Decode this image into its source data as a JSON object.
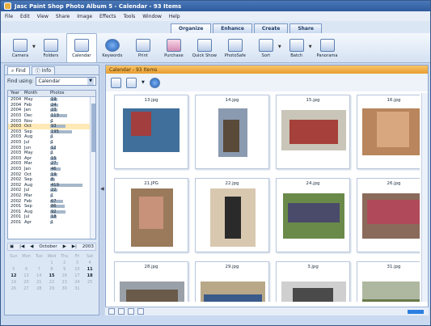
{
  "window": {
    "title": "Jasc Paint Shop Photo Album 5 - Calendar - 93 Items"
  },
  "menu": [
    "File",
    "Edit",
    "View",
    "Share",
    "Image",
    "Effects",
    "Tools",
    "Window",
    "Help"
  ],
  "mode_tabs": [
    "Organize",
    "Enhance",
    "Create",
    "Share"
  ],
  "toolbar": [
    {
      "label": "Camera",
      "icon": "camera-icon"
    },
    {
      "label": "Folders",
      "icon": "folders-icon"
    },
    {
      "label": "Calendar",
      "icon": "calendar-icon",
      "active": true
    },
    {
      "label": "Keywords",
      "icon": "keywords-icon"
    },
    {
      "label": "Print",
      "icon": "print-icon"
    },
    {
      "label": "Purchase",
      "icon": "purchase-icon"
    },
    {
      "label": "Quick Show",
      "icon": "quick-show-icon"
    },
    {
      "label": "PhotoSafe",
      "icon": "photosafe-icon"
    },
    {
      "label": "Sort",
      "icon": "sort-icon"
    },
    {
      "label": "Batch",
      "icon": "batch-icon"
    },
    {
      "label": "Panorama",
      "icon": "panorama-icon"
    }
  ],
  "left": {
    "tabs": [
      "Find",
      "Info"
    ],
    "find_label": "Find using:",
    "find_value": "Calendar",
    "columns": [
      "Year",
      "Month",
      "Photos"
    ],
    "rows": [
      [
        "2004",
        "May",
        "19"
      ],
      [
        "2004",
        "Feb",
        "24"
      ],
      [
        "2004",
        "Jan",
        "23"
      ],
      [
        "2003",
        "Dec",
        "113"
      ],
      [
        "2003",
        "Nov",
        "1"
      ],
      [
        "2003",
        "Oct",
        "93"
      ],
      [
        "2003",
        "Sep",
        "195"
      ],
      [
        "2003",
        "Aug",
        "1"
      ],
      [
        "2003",
        "Jul",
        "1"
      ],
      [
        "2003",
        "Jun",
        "12"
      ],
      [
        "2003",
        "May",
        "1"
      ],
      [
        "2003",
        "Apr",
        "15"
      ],
      [
        "2003",
        "Mar",
        "27"
      ],
      [
        "2003",
        "Jan",
        "46"
      ],
      [
        "2002",
        "Oct",
        "19"
      ],
      [
        "2002",
        "Sep",
        "8"
      ],
      [
        "2002",
        "Aug",
        "419"
      ],
      [
        "2002",
        "Jul",
        "22"
      ],
      [
        "2002",
        "Mar",
        "1"
      ],
      [
        "2002",
        "Feb",
        "67"
      ],
      [
        "2001",
        "Sep",
        "86"
      ],
      [
        "2001",
        "Aug",
        "92"
      ],
      [
        "2001",
        "Jul",
        "18"
      ],
      [
        "2001",
        "Apr",
        "1"
      ]
    ],
    "selected_row": 5,
    "month_label": "October",
    "year_label": "2003",
    "day_headers": [
      "Sun",
      "Mon",
      "Tue",
      "Wed",
      "Thu",
      "Fri",
      "Sat"
    ],
    "days": [
      "",
      "",
      "",
      "1",
      "2",
      "3",
      "4",
      "5",
      "6",
      "7",
      "8",
      "9",
      "10",
      "11",
      "12",
      "13",
      "14",
      "15",
      "16",
      "17",
      "18",
      "19",
      "20",
      "21",
      "22",
      "23",
      "24",
      "25",
      "26",
      "27",
      "28",
      "29",
      "30",
      "31",
      ""
    ],
    "bold_days": [
      "11",
      "12",
      "15",
      "18"
    ]
  },
  "main": {
    "header": "Calendar - 93 Items",
    "thumbnails": [
      "13.jpg",
      "14.jpg",
      "15.jpg",
      "16.jpg",
      "21.JPG",
      "22.jpg",
      "24.jpg",
      "26.jpg",
      "28.jpg",
      "29.jpg",
      "3.jpg",
      "31.jpg"
    ]
  }
}
